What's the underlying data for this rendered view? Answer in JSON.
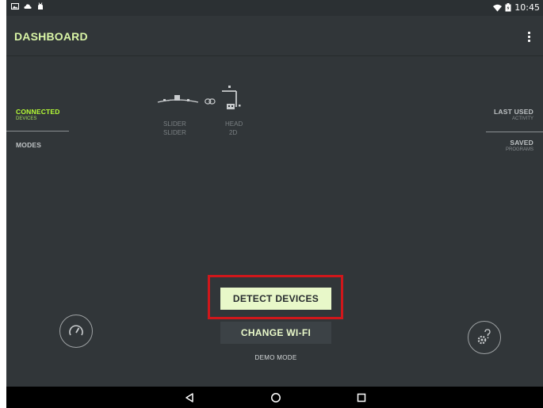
{
  "status_bar": {
    "time": "10:45",
    "left_icons": [
      "image-icon",
      "cloud-sync-icon",
      "android-icon"
    ],
    "right_icons": [
      "wifi-icon",
      "battery-icon"
    ]
  },
  "app_bar": {
    "title": "DASHBOARD",
    "menu_icon": "overflow-menu-icon"
  },
  "left_nav": {
    "connected": {
      "label": "CONNECTED",
      "sub": "DEVICES"
    },
    "modes": {
      "label": "MODES"
    }
  },
  "right_nav": {
    "last_used": {
      "label": "LAST USED",
      "sub": "ACTIVITY"
    },
    "saved": {
      "label": "SAVED",
      "sub": "PROGRAMS"
    }
  },
  "devices": [
    {
      "name": "SLIDER",
      "sub": "SLIDER",
      "icon": "slider-icon"
    },
    {
      "name": "HEAD",
      "sub": "2D",
      "icon": "head-icon"
    }
  ],
  "link_icon": "link-icon",
  "actions": {
    "detect": "DETECT DEVICES",
    "wifi": "CHANGE WI-FI",
    "demo": "DEMO MODE"
  },
  "corner_buttons": {
    "left": "speedometer-icon",
    "right": "settings-help-icon"
  },
  "system_nav": [
    "back-icon",
    "home-icon",
    "recents-icon"
  ],
  "colors": {
    "accent": "#b7ff36",
    "title": "#d9f5a6",
    "background": "#313639",
    "highlight": "#d0171b",
    "button": "#e8f8c9"
  }
}
